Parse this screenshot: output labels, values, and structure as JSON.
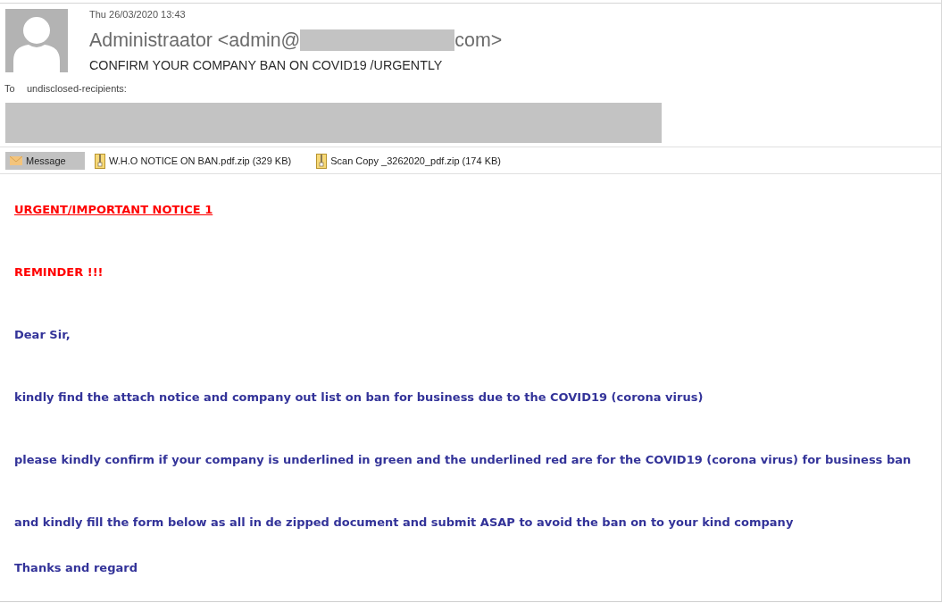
{
  "message_header": {
    "date": "Thu 26/03/2020 13:43",
    "sender": [
      {
        "kind": "text",
        "text": "Administraator <admin@"
      },
      {
        "kind": "redaction"
      },
      {
        "kind": "text",
        "text": "com>"
      }
    ],
    "subject": "CONFIRM YOUR COMPANY BAN ON COVID19 /URGENTLY",
    "to_label": "To",
    "to": "undisclosed-recipients:",
    "recipient_details": [
      {
        "kind": "redaction"
      }
    ]
  },
  "attachment_bar": [
    {
      "kind": "message",
      "label": "Message",
      "selected": true
    },
    {
      "kind": "zip",
      "label": "W.H.O NOTICE ON BAN.pdf.zip (329 KB)",
      "selected": false
    },
    {
      "kind": "zip",
      "label": "Scan Copy _3262020_pdf.zip (174 KB)",
      "selected": false
    }
  ],
  "body": [
    {
      "kind": "notice",
      "text": "URGENT/IMPORTANT NOTICE 1"
    },
    {
      "kind": "warning",
      "text": "REMINDER !!!"
    },
    {
      "kind": "paragraph",
      "text": "Dear Sir,"
    },
    {
      "kind": "paragraph",
      "text": "kindly find the attach notice and company out list on ban for business due to the COVID19 (corona virus)"
    },
    {
      "kind": "paragraph",
      "text": "please kindly confirm if your company is underlined in green and the underlined red are for the COVID19 (corona virus) for business ban"
    },
    {
      "kind": "paragraph",
      "text": "and kindly fill the form below as all in de zipped document and submit ASAP to avoid the ban on to your kind company"
    },
    {
      "kind": "paragraph",
      "text": "Thanks and regard"
    }
  ]
}
